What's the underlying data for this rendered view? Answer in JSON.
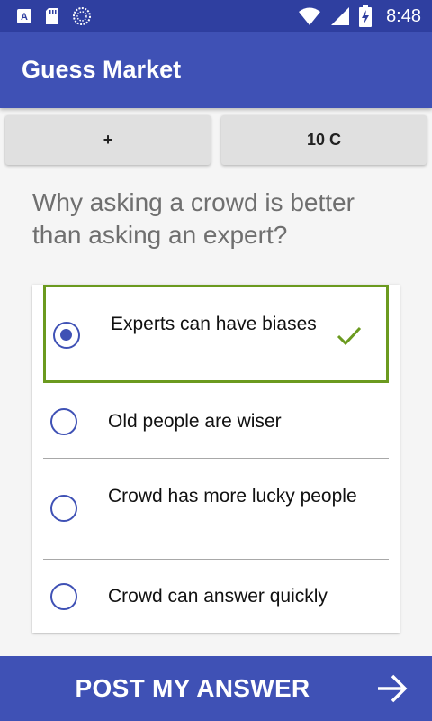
{
  "status_bar": {
    "time": "8:48",
    "icons": [
      "a-notification-icon",
      "sd-card-icon",
      "sync-icon",
      "wifi-icon",
      "signal-icon",
      "battery-charging-icon"
    ]
  },
  "app_bar": {
    "title": "Guess Market"
  },
  "top_buttons": {
    "plus_label": "+",
    "coins_label": "10 C"
  },
  "question": {
    "text": "Why asking a crowd is better than asking an expert?"
  },
  "answers": [
    {
      "label": "Experts can have biases",
      "selected": true,
      "correct": true
    },
    {
      "label": "Old people are wiser",
      "selected": false
    },
    {
      "label": "Crowd has more lucky people",
      "selected": false
    },
    {
      "label": "Crowd can answer quickly",
      "selected": false
    }
  ],
  "post_bar": {
    "label": "POST MY ANSWER",
    "icon": "arrow-right-icon"
  },
  "colors": {
    "status_bar": "#2f3fa0",
    "primary": "#3f51b5",
    "correct": "#6b9a1f",
    "question_text": "#6f6f6f"
  }
}
